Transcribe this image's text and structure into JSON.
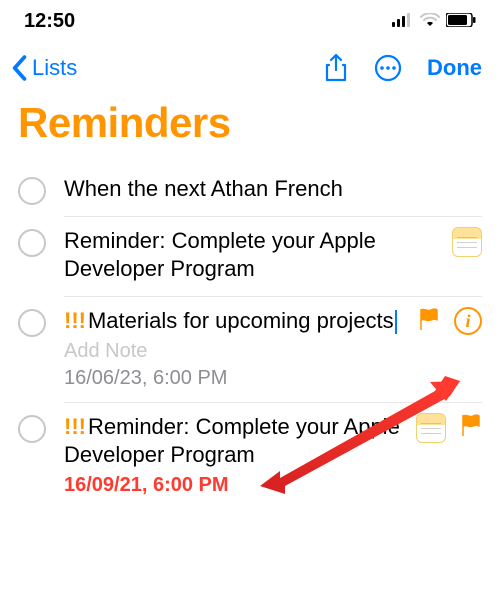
{
  "status": {
    "time": "12:50"
  },
  "nav": {
    "back_label": "Lists",
    "done_label": "Done"
  },
  "page": {
    "title": "Reminders"
  },
  "items": [
    {
      "priority": "",
      "title": "When the next Athan French",
      "note": null,
      "date": null,
      "overdue": false,
      "has_notes_attachment": false,
      "flagged": false,
      "show_info": false,
      "editing": false
    },
    {
      "priority": "",
      "title": "Reminder: Complete your Apple Developer Program",
      "note": null,
      "date": null,
      "overdue": false,
      "has_notes_attachment": true,
      "flagged": false,
      "show_info": false,
      "editing": false
    },
    {
      "priority": "!!!",
      "title": "Materials for upcoming projects",
      "note": "Add Note",
      "date": "16/06/23, 6:00 PM",
      "overdue": false,
      "has_notes_attachment": false,
      "flagged": true,
      "show_info": true,
      "editing": true
    },
    {
      "priority": "!!!",
      "title": "Reminder: Complete your Apple Developer Program",
      "note": null,
      "date": "16/09/21, 6:00 PM",
      "overdue": true,
      "has_notes_attachment": true,
      "flagged": true,
      "show_info": false,
      "editing": false
    }
  ]
}
